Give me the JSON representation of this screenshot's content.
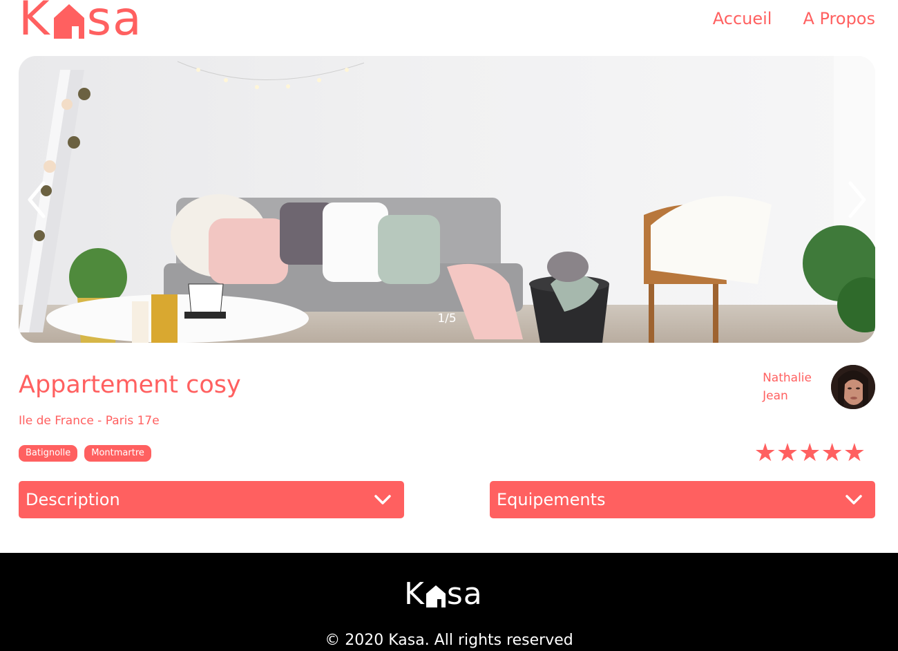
{
  "header": {
    "logo": {
      "letter_k": "K",
      "letters_sa": "sa"
    },
    "nav": [
      {
        "label": "Accueil"
      },
      {
        "label": "A Propos"
      }
    ]
  },
  "carousel": {
    "counter": "1/5",
    "prev_icon": "chevron-left-icon",
    "next_icon": "chevron-right-icon"
  },
  "listing": {
    "title": "Appartement cosy",
    "location": "Ile de France - Paris 17e",
    "tags": [
      "Batignolle",
      "Montmartre"
    ],
    "host": {
      "first_name": "Nathalie",
      "last_name": "Jean"
    },
    "rating": 5,
    "rating_max": 5
  },
  "collapses": [
    {
      "label": "Description",
      "icon": "chevron-down-icon"
    },
    {
      "label": "Equipements",
      "icon": "chevron-down-icon"
    }
  ],
  "footer": {
    "logo": {
      "letter_k": "K",
      "letters_sa": "sa"
    },
    "copyright": "© 2020 Kasa. All rights reserved"
  },
  "colors": {
    "brand": "#FF6060",
    "footer_bg": "#000000",
    "text_light": "#FFFFFF"
  }
}
